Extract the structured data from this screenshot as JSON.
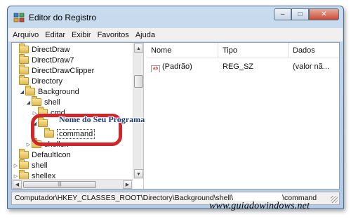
{
  "window": {
    "title": "Editor do Registro",
    "controls": {
      "minimize": "–",
      "maximize": "□",
      "close": "✕"
    }
  },
  "menu": [
    "Arquivo",
    "Editar",
    "Exibir",
    "Favoritos",
    "Ajuda"
  ],
  "tree": {
    "items": [
      {
        "label": "DirectDraw",
        "arrow": "",
        "selected": false
      },
      {
        "label": "DirectDraw7",
        "arrow": "",
        "selected": false
      },
      {
        "label": "DirectDrawClipper",
        "arrow": "",
        "selected": false
      },
      {
        "label": "Directory",
        "arrow": "",
        "selected": false
      },
      {
        "label": "Background",
        "arrow": "◢",
        "selected": false
      },
      {
        "label": "shell",
        "arrow": "◢",
        "selected": false
      },
      {
        "label": "cmd",
        "arrow": "▷",
        "selected": false
      },
      {
        "label": "",
        "arrow": "◢",
        "selected": false
      },
      {
        "label": "command",
        "arrow": "",
        "selected": true
      },
      {
        "label": "shellex",
        "arrow": "▷",
        "selected": false
      },
      {
        "label": "DefaultIcon",
        "arrow": "",
        "selected": false
      },
      {
        "label": "shell",
        "arrow": "▷",
        "selected": false
      },
      {
        "label": "shellex",
        "arrow": "▷",
        "selected": false
      }
    ],
    "hscroll_grip": "|||"
  },
  "list": {
    "columns": [
      "Nome",
      "Tipo",
      "Dados"
    ],
    "rows": [
      {
        "icon": "ab",
        "name": "(Padrão)",
        "type": "REG_SZ",
        "data": "(valor nã..."
      }
    ]
  },
  "statusbar": {
    "path_prefix": "Computador\\HKEY_CLASSES_ROOT\\Directory\\Background\\shell\\",
    "path_suffix": "\\command"
  },
  "annotation": {
    "callout": "Nome do Seu Programa",
    "highlight_color": "#d0252b"
  },
  "watermark": "www.guiadowindows.net",
  "icons": {
    "app": "registry-editor-icon",
    "folder": "folder-icon",
    "value": "string-value-icon"
  },
  "colors": {
    "title_bar": "#b3cbe4",
    "callout_text": "#1e3a7a",
    "folder": "#e2b84a"
  }
}
